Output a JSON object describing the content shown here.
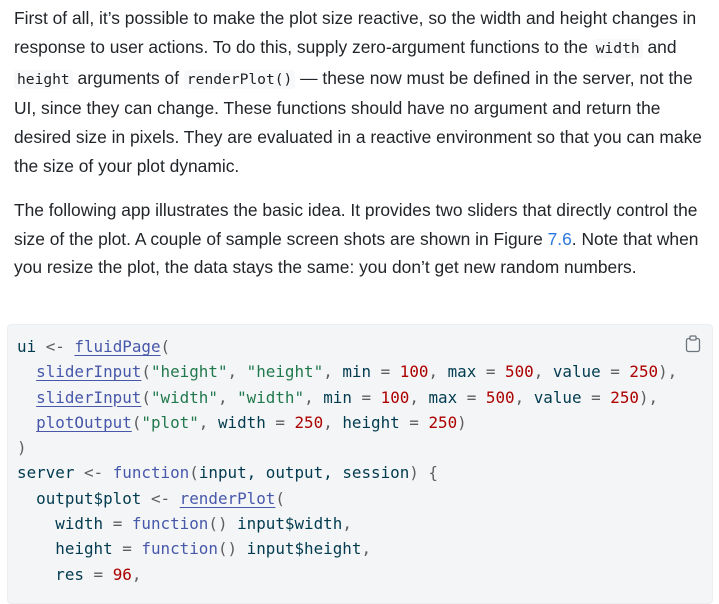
{
  "para1": {
    "t1": "First of all, it’s possible to make the plot size reactive, so the width and height changes in response to user actions. To do this, supply zero-argument functions to the ",
    "c1": "width",
    "t2": " and ",
    "c2": "height",
    "t3": " arguments of ",
    "c3": "renderPlot()",
    "t4": " — these now must be defined in the server, not the UI, since they can change. These functions should have no argument and return the desired size in pixels. They are evaluated in a reactive environment so that you can make the size of your plot dynamic."
  },
  "para2": {
    "t1": "The following app illustrates the basic idea. It provides two sliders that directly control the size of the plot. A couple of sample screen shots are shown in Figure ",
    "link": "7.6",
    "t2": ". Note that when you resize the plot, the data stays the same: you don’t get new random numbers."
  },
  "code": {
    "l1": {
      "a": "ui",
      "b": " <- ",
      "c": "fluidPage",
      "d": "("
    },
    "l2": {
      "ind": "  ",
      "fn": "sliderInput",
      "p1": "(",
      "s1": "\"height\"",
      "c1": ", ",
      "s2": "\"height\"",
      "c2": ", ",
      "k1": "min",
      "e1": " = ",
      "n1": "100",
      "c3": ", ",
      "k2": "max",
      "e2": " = ",
      "n2": "500",
      "c4": ", ",
      "k3": "value",
      "e3": " = ",
      "n3": "250",
      "p2": "),"
    },
    "l3": {
      "ind": "  ",
      "fn": "sliderInput",
      "p1": "(",
      "s1": "\"width\"",
      "c1": ", ",
      "s2": "\"width\"",
      "c2": ", ",
      "k1": "min",
      "e1": " = ",
      "n1": "100",
      "c3": ", ",
      "k2": "max",
      "e2": " = ",
      "n2": "500",
      "c4": ", ",
      "k3": "value",
      "e3": " = ",
      "n3": "250",
      "p2": "),"
    },
    "l4": {
      "ind": "  ",
      "fn": "plotOutput",
      "p1": "(",
      "s1": "\"plot\"",
      "c1": ", ",
      "k1": "width",
      "e1": " = ",
      "n1": "250",
      "c2": ", ",
      "k2": "height",
      "e2": " = ",
      "n2": "250",
      "p2": ")"
    },
    "l5": {
      "a": ")"
    },
    "l6": {
      "a": "server",
      "b": " <- ",
      "kw": "function",
      "p1": "(",
      "args": "input, output, session",
      "p2": ") {"
    },
    "l7": {
      "ind": "  ",
      "a": "output$plot",
      "b": " <- ",
      "fn": "renderPlot",
      "p1": "("
    },
    "l8": {
      "ind": "    ",
      "k": "width",
      "e": " = ",
      "kw": "function",
      "p": "() ",
      "v": "input$width",
      "c": ","
    },
    "l9": {
      "ind": "    ",
      "k": "height",
      "e": " = ",
      "kw": "function",
      "p": "() ",
      "v": "input$height",
      "c": ","
    },
    "l10": {
      "ind": "    ",
      "k": "res",
      "e": " = ",
      "n": "96",
      "c": ","
    }
  }
}
